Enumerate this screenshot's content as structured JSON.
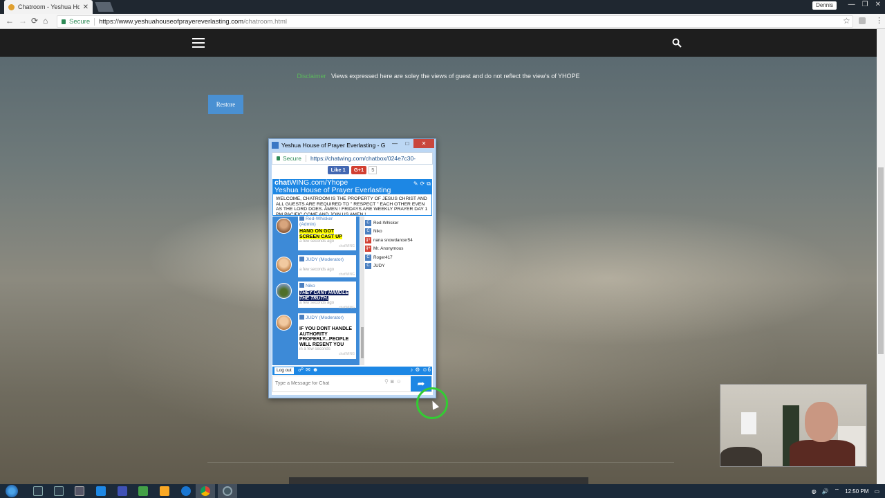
{
  "browser": {
    "tab_title": "Chatroom - Yeshua House",
    "profile_name": "Dennis",
    "secure_label": "Secure",
    "url_host": "https://www.yeshuahouseofprayereverlasting.com",
    "url_path": "/chatroom.html"
  },
  "page": {
    "disclaimer_label": "Disclaimer",
    "disclaimer_text": "Views expressed here are soley the views of guest and do not reflect the view's of YHOPE",
    "restore_label": "Restore"
  },
  "popup": {
    "title": "Yeshua House of Prayer Everlasting - Go...",
    "secure_label": "Secure",
    "url": "https://chatwing.com/chatbox/024e7c30-",
    "fb_like": "Like 1",
    "gplus": "G+1",
    "gplus_count": "5",
    "brand_bold": "chat",
    "brand_rest": "WING.com/Yhope",
    "subtitle": "Yeshua House of Prayer Everlasting",
    "welcome": "WELCOME, CHATROOM IS THE PROPERTY OF JESUS CHRIST AND ALL GUESTS ARE REQUIRED TO \" RESPECT \" EACH OTHER EVEN AS THE LORD DOES. AMEN ! FRIDAYS ARE WEEKLY PRAYER DAY 1 PM PACIFIC COME AND JOIN US AMEN !",
    "messages": [
      {
        "user": "Red-Whisker",
        "role": "(Admin)",
        "text": "HANG ON GOT SCREEN CAST UP",
        "time": "a few seconds ago",
        "brand": "chatWING"
      },
      {
        "user": "JUDY (Moderator)",
        "role": "",
        "text": "",
        "time": "a few seconds ago",
        "brand": "chatWING"
      },
      {
        "user": "Niko",
        "role": "",
        "text": "THEY CANT HANDLE THE TRUTH.",
        "time": "a few seconds ago",
        "brand": "chatWING"
      },
      {
        "user": "JUDY (Moderator)",
        "role": "",
        "text": "IF YOU DONT HANDLE AUTHORITY PROPERLY...PEOPLE WILL RESENT YOU",
        "time": "in a few seconds",
        "brand": "chatWING"
      }
    ],
    "users": [
      {
        "name": "Red-Whisker",
        "badge": "C"
      },
      {
        "name": "Niko",
        "badge": "C"
      },
      {
        "name": "nana snowdancer54",
        "badge": "g+"
      },
      {
        "name": "Mr. Anonymous",
        "badge": "g+"
      },
      {
        "name": "Roger417",
        "badge": "C"
      },
      {
        "name": "JUDY",
        "badge": "C"
      }
    ],
    "logout_label": "Log out",
    "online_count": "6",
    "input_placeholder": "Type a Message for Chat"
  },
  "taskbar": {
    "time": "12:50 PM"
  },
  "colors": {
    "chatwing_blue": "#1d87e4",
    "restore_blue": "#4a90d2",
    "disclaimer_green": "#5cb85c"
  }
}
